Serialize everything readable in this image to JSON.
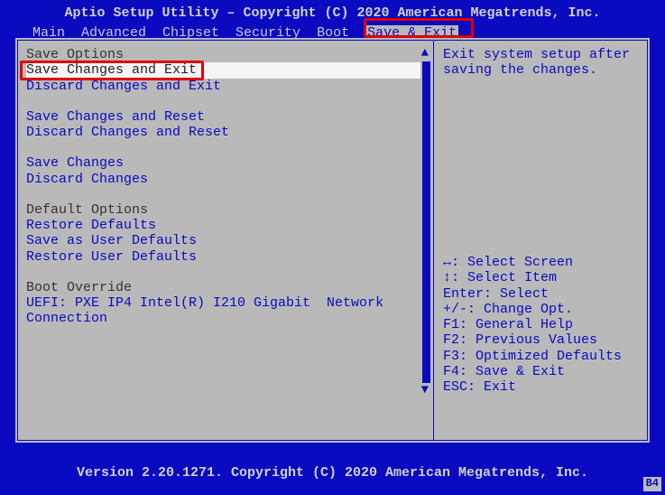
{
  "title": "Aptio Setup Utility – Copyright (C) 2020 American Megatrends, Inc.",
  "tabs": [
    {
      "label": "Main",
      "active": false
    },
    {
      "label": "Advanced",
      "active": false
    },
    {
      "label": "Chipset",
      "active": false
    },
    {
      "label": "Security",
      "active": false
    },
    {
      "label": "Boot",
      "active": false
    },
    {
      "label": "Save & Exit",
      "active": true
    }
  ],
  "left": {
    "groups": [
      {
        "header": "Save Options",
        "items": [
          {
            "label": "Save Changes and Exit",
            "selected": true
          },
          {
            "label": "Discard Changes and Exit",
            "selected": false
          }
        ]
      },
      {
        "header": "",
        "items": [
          {
            "label": "Save Changes and Reset",
            "selected": false
          },
          {
            "label": "Discard Changes and Reset",
            "selected": false
          }
        ]
      },
      {
        "header": "",
        "items": [
          {
            "label": "Save Changes",
            "selected": false
          },
          {
            "label": "Discard Changes",
            "selected": false
          }
        ]
      },
      {
        "header": "Default Options",
        "items": [
          {
            "label": "Restore Defaults",
            "selected": false
          },
          {
            "label": "Save as User Defaults",
            "selected": false
          },
          {
            "label": "Restore User Defaults",
            "selected": false
          }
        ]
      },
      {
        "header": "Boot Override",
        "items": [
          {
            "label": "UEFI: PXE IP4 Intel(R) I210 Gigabit  Network Connection",
            "selected": false
          }
        ]
      }
    ]
  },
  "help_text": "Exit system setup after saving the changes.",
  "keyhints": [
    "↔: Select Screen",
    "↕: Select Item",
    "Enter: Select",
    "+/-: Change Opt.",
    "F1: General Help",
    "F2: Previous Values",
    "F3: Optimized Defaults",
    "F4: Save & Exit",
    "ESC: Exit"
  ],
  "footer": "Version 2.20.1271. Copyright (C) 2020 American Megatrends, Inc.",
  "mark": "B4",
  "colors": {
    "bg_blue": "#0a0ac0",
    "panel_grey": "#b9b9b9",
    "red": "#e00000"
  }
}
